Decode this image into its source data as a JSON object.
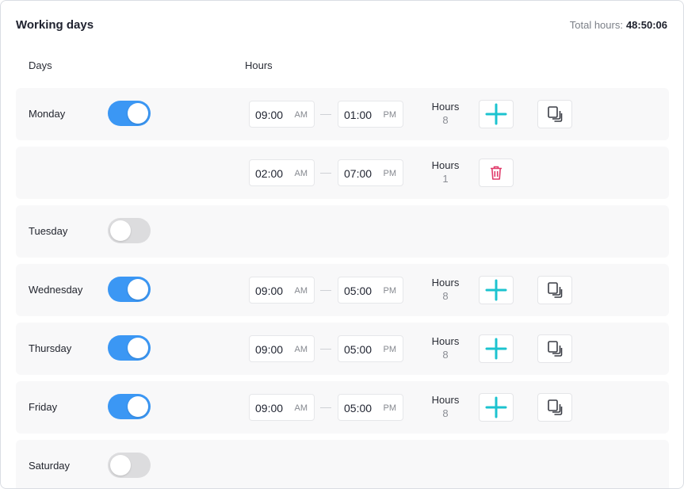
{
  "header": {
    "title": "Working days",
    "total_label": "Total hours:",
    "total_value": "48:50:06"
  },
  "columns": {
    "days": "Days",
    "hours": "Hours"
  },
  "colors": {
    "toggle_on": "#3b97f4",
    "toggle_off": "#dcdcde",
    "add": "#1cc3cf",
    "delete": "#e03a6a"
  },
  "rows": [
    {
      "day": "Monday",
      "enabled": true,
      "start": "09:00",
      "start_ampm": "AM",
      "end": "01:00",
      "end_ampm": "PM",
      "hours_label": "Hours",
      "hours": "8",
      "action": "add"
    },
    {
      "day": "",
      "enabled": null,
      "start": "02:00",
      "start_ampm": "AM",
      "end": "07:00",
      "end_ampm": "PM",
      "hours_label": "Hours",
      "hours": "1",
      "action": "delete"
    },
    {
      "day": "Tuesday",
      "enabled": false
    },
    {
      "day": "Wednesday",
      "enabled": true,
      "start": "09:00",
      "start_ampm": "AM",
      "end": "05:00",
      "end_ampm": "PM",
      "hours_label": "Hours",
      "hours": "8",
      "action": "add"
    },
    {
      "day": "Thursday",
      "enabled": true,
      "start": "09:00",
      "start_ampm": "AM",
      "end": "05:00",
      "end_ampm": "PM",
      "hours_label": "Hours",
      "hours": "8",
      "action": "add"
    },
    {
      "day": "Friday",
      "enabled": true,
      "start": "09:00",
      "start_ampm": "AM",
      "end": "05:00",
      "end_ampm": "PM",
      "hours_label": "Hours",
      "hours": "8",
      "action": "add"
    },
    {
      "day": "Saturday",
      "enabled": false
    }
  ]
}
